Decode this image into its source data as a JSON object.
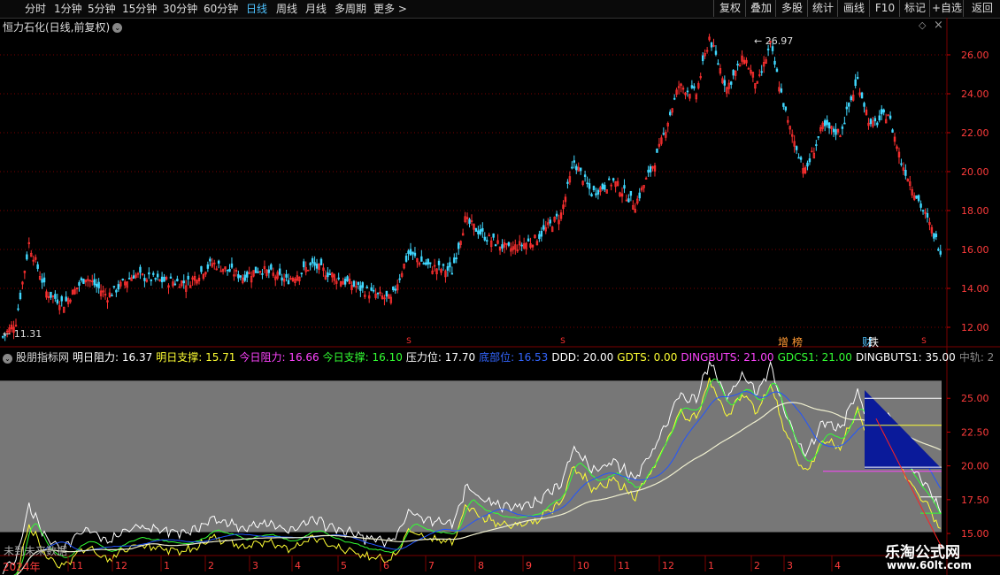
{
  "toolbar": {
    "tabs": [
      "分时",
      "1分钟",
      "5分钟",
      "15分钟",
      "30分钟",
      "60分钟",
      "日线",
      "周线",
      "月线",
      "多周期",
      "更多 >"
    ],
    "active_tab": "日线",
    "right_buttons": [
      "复权",
      "叠加",
      "多股",
      "统计",
      "画线",
      "F10",
      "标记",
      "+自选",
      "返回"
    ]
  },
  "chart_title": "恒力石化(日线,前复权)",
  "price_chart": {
    "y_ticks": [
      "26.00",
      "24.00",
      "22.00",
      "20.00",
      "18.00",
      "16.00",
      "14.00",
      "12.00"
    ],
    "y_values": [
      26,
      24,
      22,
      20,
      18,
      16,
      14,
      12
    ],
    "ylim": [
      11.0,
      27.0
    ],
    "high_label": "26.97",
    "low_label": "11.31",
    "markers": [
      "S",
      "S",
      "S"
    ],
    "marker_tags": [
      "增",
      "榜",
      "财",
      "跌"
    ]
  },
  "indicator": {
    "name": "股朋指标网",
    "values": [
      {
        "label": "明日阻力:",
        "value": "16.37",
        "color": "#ffffff"
      },
      {
        "label": "明日支撑:",
        "value": "15.71",
        "color": "#ffff33"
      },
      {
        "label": "今日阻力:",
        "value": "16.66",
        "color": "#ff44ff"
      },
      {
        "label": "今日支撑:",
        "value": "16.10",
        "color": "#33ff33"
      },
      {
        "label": "压力位:",
        "value": "17.70",
        "color": "#ffffff"
      },
      {
        "label": "底部位:",
        "value": "16.53",
        "color": "#3366ff"
      },
      {
        "label": "DDD:",
        "value": "20.00",
        "color": "#ffffff"
      },
      {
        "label": "GDTS:",
        "value": "0.00",
        "color": "#ffff33"
      },
      {
        "label": "DINGBUTS:",
        "value": "21.00",
        "color": "#ff44ff"
      },
      {
        "label": "GDCS1:",
        "value": "21.00",
        "color": "#33ff33"
      },
      {
        "label": "DINGBUTS1:",
        "value": "35.00",
        "color": "#ffffff"
      },
      {
        "label": "中轨:",
        "value": "2",
        "color": "#888888"
      }
    ],
    "y_ticks": [
      "25.00",
      "22.50",
      "20.00",
      "17.50",
      "15.00"
    ],
    "y_values": [
      25,
      22.5,
      20,
      17.5,
      15
    ],
    "ylim": [
      13.5,
      27.5
    ]
  },
  "time_axis": {
    "year_label": "2024年",
    "months": [
      "11",
      "12",
      "1",
      "2",
      "3",
      "4",
      "5",
      "6",
      "7",
      "8",
      "9",
      "10",
      "11",
      "12",
      "1",
      "2",
      "3",
      "4"
    ]
  },
  "future_data_label": "未到未来数据",
  "watermark": {
    "title": "乐淘公式网",
    "url": "www.60lt.com"
  }
}
